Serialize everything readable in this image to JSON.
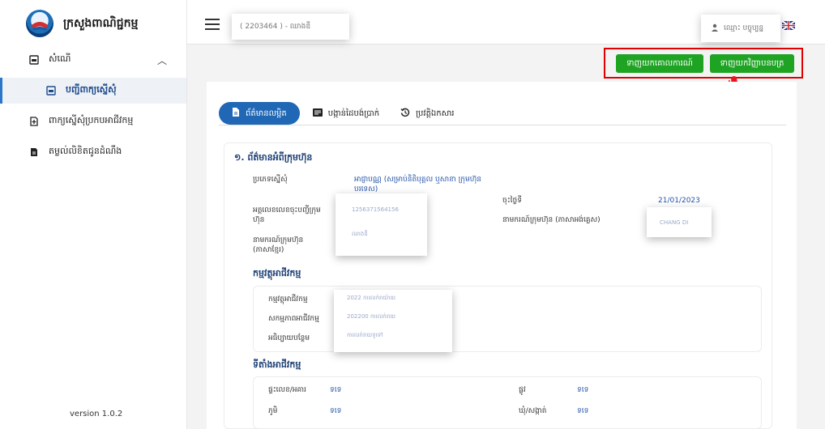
{
  "brand": {
    "title": "ក្រសួងពាណិជ្ជកម្ម"
  },
  "sidebar": {
    "items": [
      {
        "label": "សំណើ",
        "icon": "inbox-icon"
      },
      {
        "label": "បញ្ជីពាក្យស្នើសុំ",
        "icon": "inbox-icon"
      },
      {
        "label": "ពាក្យស្នើសុំប្រកបអាជីវកម្ម",
        "icon": "add-file-icon"
      },
      {
        "label": "តម្លល់លិខិតជូនដំណឹង",
        "icon": "document-icon"
      }
    ],
    "version": "version 1.0.2"
  },
  "header": {
    "breadcrumb": "( 2203464 ) - ឈាងឌី",
    "user": "ឈ្មោះ បច្ចុប្បន្ន",
    "language": "EN"
  },
  "actions": {
    "btn_certificate": "ទាញយកគោលការណ៍",
    "btn_permit": "ទាញយកវិញ្ញាបនបត្រ"
  },
  "tabs": [
    {
      "label": "ព័ត៌មានលម្អិត",
      "icon": "document-icon"
    },
    {
      "label": "បង្កាន់ដៃបង់ប្រាក់",
      "icon": "receipt-icon"
    },
    {
      "label": "ប្រវត្តិឯកសារ",
      "icon": "history-icon"
    }
  ],
  "company": {
    "title": "១. ព័ត៌មានអំពីក្រុមហ៊ុន",
    "request_type_label": "ប្រភេទស្នើសុំ",
    "request_type_value": "អាជ្ញាបណ្ណ (សម្រាប់និតិបុគ្គល ឬសាខា ក្រុមហ៊ុនបរទេស)",
    "registration_no_label": "អត្តលេខលេខចុះបញ្ជីក្រុមហ៊ុន",
    "registration_no_value": "1256371564156",
    "registration_date_label": "ចុះថ្ងៃទី",
    "registration_date_value": "21/01/2023",
    "name_en_label": "នាមករណ៍ក្រុមហ៊ុន (ភាសាអង់គ្លេស)",
    "name_en_value": "CHANG DI",
    "name_kh_label": "នាមករណ៍ក្រុមហ៊ុន (ភាសាខ្មែរ)",
    "name_kh_value": "ឈាងឌី"
  },
  "business": {
    "title": "កម្មវត្ថុអាជីវកម្ម",
    "objective_label": "កម្មវត្ថុអាជីវកម្ម",
    "objective_value": "2022 ការលក់រាយ៉ាយ",
    "activity_label": "សកម្មភាពអាជីវកម្ម",
    "activity_value": "202200 ការលក់រាយ",
    "description_label": "អធិប្បាយបន្ថែម",
    "description_value": "ការលក់រាយទូទៅ"
  },
  "location": {
    "title": "ទីតាំងអាជីវកម្ម",
    "house_label": "ផ្ទះលេខ/អគារ",
    "house_value": "ទទេ",
    "street_label": "ផ្លូវ",
    "street_value": "ទទេ",
    "village_label": "ភូមិ",
    "village_value": "ទទេ",
    "commune_label": "ឃុំ/សង្កាត់",
    "commune_value": "ទទេ"
  },
  "colors": {
    "primary": "#2067b5",
    "success": "#1ea323",
    "highlight": "#e00000"
  }
}
